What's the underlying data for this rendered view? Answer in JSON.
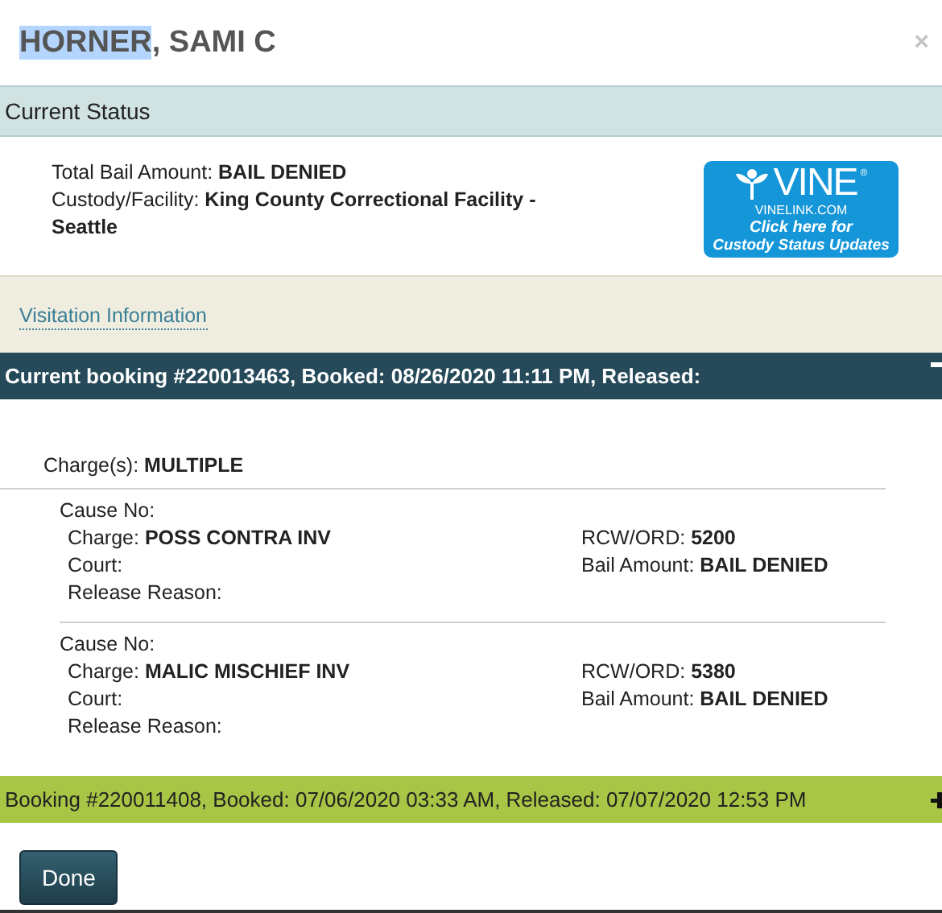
{
  "dialog": {
    "title": {
      "selected_text": "HORNER",
      "text": ", SAMI C"
    },
    "close": "×"
  },
  "current_status": {
    "heading": "Current Status",
    "fields": [
      {
        "label": "Total Bail Amount:",
        "value": "BAIL DENIED"
      },
      {
        "label": "Custody/Facility:",
        "value": "King County Correctional Facility - Seattle"
      }
    ],
    "vine_badge": {
      "brand": "VINE",
      "mark": "®",
      "site": "VINELINK.COM",
      "line_1": "Click here for",
      "line_2": "Custody Status Updates"
    }
  },
  "visitation_link": "Visitation Information",
  "bookings": [
    {
      "title": "Current booking #220013463, Booked: 08/26/2020 11:11 PM, Released:",
      "expanded": true,
      "charges_label": "Charge(s):",
      "charges_value": "MULTIPLE",
      "charges": [
        {
          "cause_no": "Cause No:",
          "charge_label": "Charge:",
          "charge": "POSS CONTRA INV",
          "rcw_label": "RCW/ORD:",
          "rcw": "5200",
          "court": "Court:",
          "bail_label": "Bail Amount:",
          "bail": "BAIL DENIED",
          "release_reason": "Release Reason:"
        },
        {
          "cause_no": "Cause No:",
          "charge_label": "Charge:",
          "charge": "MALIC MISCHIEF INV",
          "rcw_label": "RCW/ORD:",
          "rcw": "5380",
          "court": "Court:",
          "bail_label": "Bail Amount:",
          "bail": "BAIL DENIED",
          "release_reason": "Release Reason:"
        }
      ]
    },
    {
      "title": "Booking #220011408, Booked: 07/06/2020 03:33 AM, Released: 07/07/2020 12:53 PM",
      "expanded": false
    }
  ],
  "buttons": [
    "Done"
  ]
}
